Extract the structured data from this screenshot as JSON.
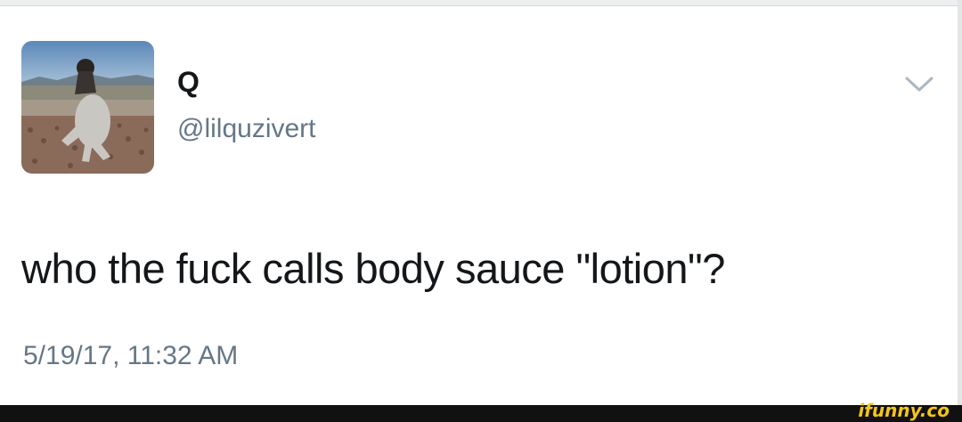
{
  "tweet": {
    "display_name": "Q",
    "handle": "@lilquzivert",
    "text": "who the fuck calls body sauce \"lotion\"?",
    "timestamp": "5/19/17, 11:32 AM"
  },
  "icons": {
    "menu": "chevron-down-icon",
    "avatar": "profile-photo"
  },
  "footer": {
    "watermark": "ifunny.co"
  },
  "colors": {
    "text_primary": "#14171a",
    "text_secondary": "#657786",
    "chevron": "#aab8c2",
    "watermark": "#f5c518"
  }
}
